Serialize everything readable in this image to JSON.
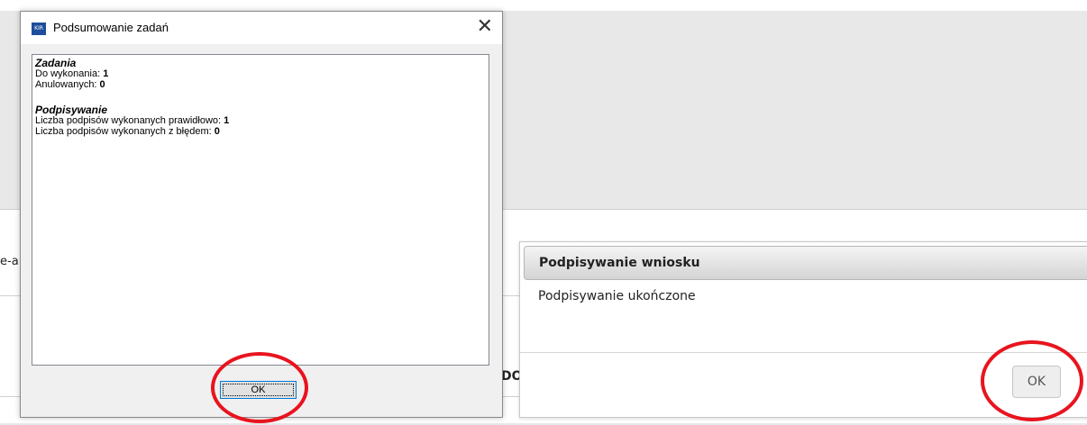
{
  "background": {
    "side_text_left": "e-a",
    "side_text_mid": "DO"
  },
  "dialog": {
    "title": "Podsumowanie zadań",
    "icon": "app-icon",
    "close_glyph": "✕",
    "sections": [
      {
        "heading": "Zadania",
        "rows": [
          {
            "label": "Do wykonania: ",
            "value": "1"
          },
          {
            "label": "Anulowanych: ",
            "value": "0"
          }
        ]
      },
      {
        "heading": "Podpisywanie",
        "rows": [
          {
            "label": "Liczba podpisów wykonanych prawidłowo: ",
            "value": "1"
          },
          {
            "label": "Liczba podpisów wykonanych z błędem: ",
            "value": "0"
          }
        ]
      }
    ],
    "ok_label": "OK"
  },
  "modal": {
    "title": "Podpisywanie wniosku",
    "message": "Podpisywanie ukończone",
    "ok_label": "OK"
  },
  "colors": {
    "annotation": "#e8141e",
    "focus_border": "#0078d7"
  }
}
